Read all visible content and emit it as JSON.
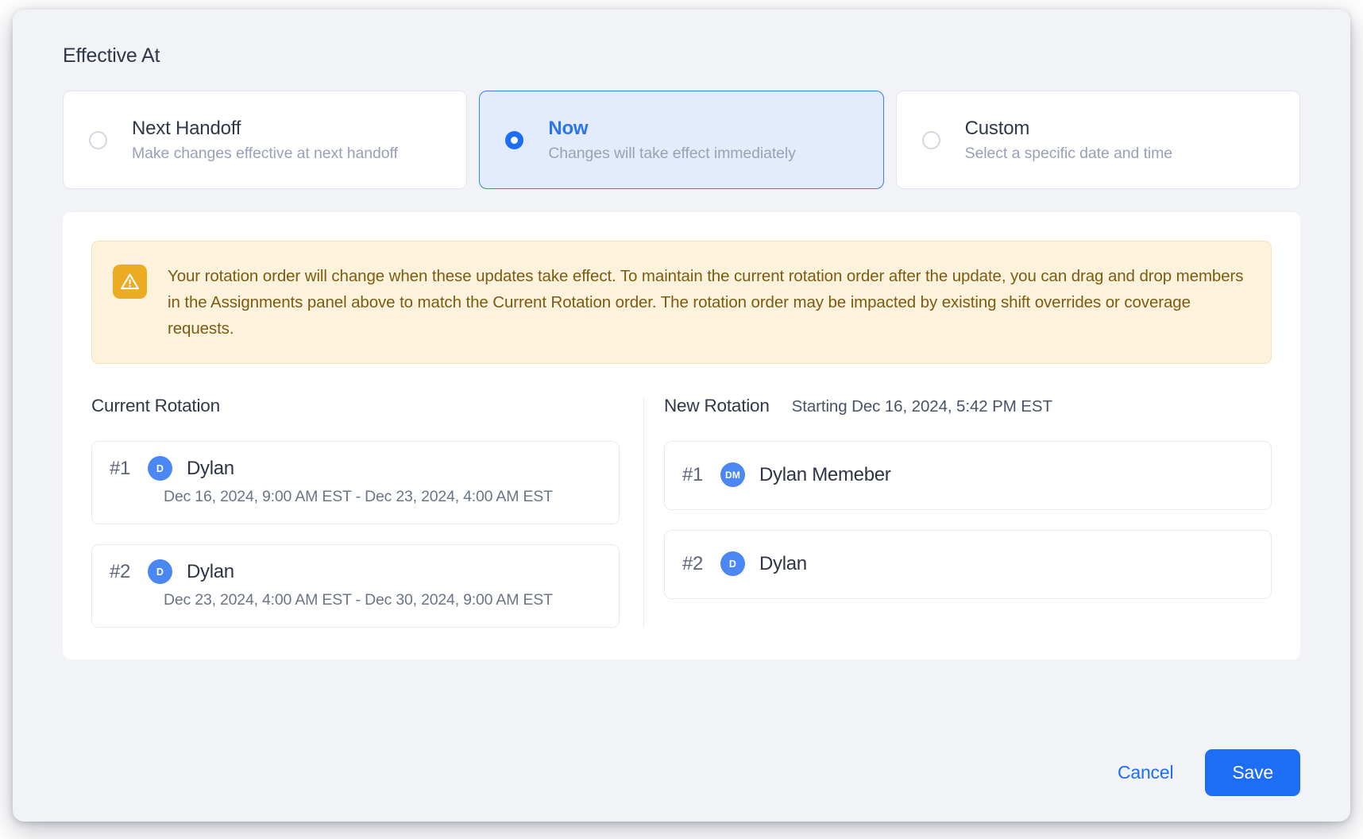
{
  "effective_at": {
    "title": "Effective At",
    "options": [
      {
        "id": "next-handoff",
        "title": "Next Handoff",
        "subtitle": "Make changes effective at next handoff",
        "selected": false
      },
      {
        "id": "now",
        "title": "Now",
        "subtitle": "Changes will take effect immediately",
        "selected": true
      },
      {
        "id": "custom",
        "title": "Custom",
        "subtitle": "Select a specific date and time",
        "selected": false
      }
    ]
  },
  "warning": {
    "icon": "warning-triangle-icon",
    "text": "Your rotation order will change when these updates take effect. To maintain the current rotation order after the update, you can drag and drop members in the Assignments panel above to match the Current Rotation order. The rotation order may be impacted by existing shift overrides or coverage requests.",
    "bg_color": "#fdf3dc",
    "icon_color": "#edab23",
    "text_color": "#7c5a13"
  },
  "current_rotation": {
    "title": "Current Rotation",
    "entries": [
      {
        "rank": "#1",
        "initials": "D",
        "name": "Dylan",
        "dates": "Dec 16, 2024, 9:00 AM EST - Dec 23, 2024, 4:00 AM EST"
      },
      {
        "rank": "#2",
        "initials": "D",
        "name": "Dylan",
        "dates": "Dec 23, 2024, 4:00 AM EST - Dec 30, 2024, 9:00 AM EST"
      }
    ]
  },
  "new_rotation": {
    "title": "New Rotation",
    "starting": "Starting Dec 16, 2024, 5:42 PM EST",
    "entries": [
      {
        "rank": "#1",
        "initials": "DM",
        "name": "Dylan Memeber"
      },
      {
        "rank": "#2",
        "initials": "D",
        "name": "Dylan"
      }
    ]
  },
  "footer": {
    "cancel_label": "Cancel",
    "save_label": "Save",
    "accent_color": "#1d6ef5"
  }
}
